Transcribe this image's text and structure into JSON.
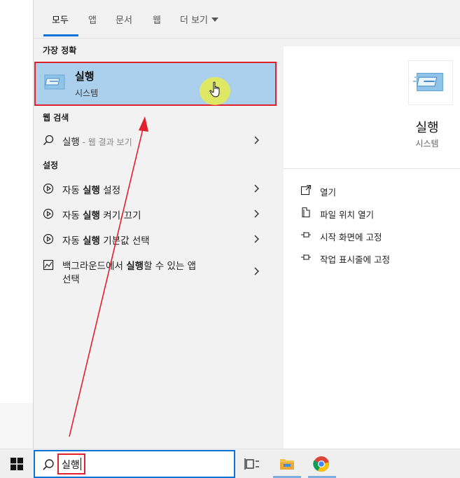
{
  "tabs": [
    {
      "label": "모두",
      "active": true
    },
    {
      "label": "앱"
    },
    {
      "label": "문서"
    },
    {
      "label": "웹"
    },
    {
      "label": "더 보기"
    }
  ],
  "best_match": {
    "section_title": "가장 정확",
    "name": "실행",
    "sub": "시스템",
    "icon": "run-app-icon"
  },
  "web_search": {
    "section_title": "웹 검색",
    "query": "실행",
    "suffix": " - 웹 결과 보기"
  },
  "settings": {
    "section_title": "설정",
    "items": [
      {
        "pre": "자동 ",
        "bold": "실행",
        "post": " 설정"
      },
      {
        "pre": "자동 ",
        "bold": "실행",
        "post": " 켜기/끄기"
      },
      {
        "pre": "자동 ",
        "bold": "실행",
        "post": " 기본값 선택"
      },
      {
        "pre": "백그라운드에서 ",
        "bold": "실행",
        "post": "할 수 있는 앱",
        "line2": "선택"
      }
    ]
  },
  "preview": {
    "name": "실행",
    "sub": "시스템",
    "actions": [
      {
        "label": "열기",
        "icon": "open-icon"
      },
      {
        "label": "파일 위치 열기",
        "icon": "file-location-icon"
      },
      {
        "label": "시작 화면에 고정",
        "icon": "pin-icon"
      },
      {
        "label": "작업 표시줄에 고정",
        "icon": "pin-icon"
      }
    ]
  },
  "taskbar": {
    "search_value": "실행",
    "icons": [
      "start-icon",
      "task-view-icon",
      "file-explorer-icon",
      "chrome-icon"
    ]
  },
  "colors": {
    "accent": "#0a74d6",
    "highlight": "#abd0ee",
    "annotation_red": "#e0202d",
    "cursor_halo": "#e7ec4c"
  }
}
